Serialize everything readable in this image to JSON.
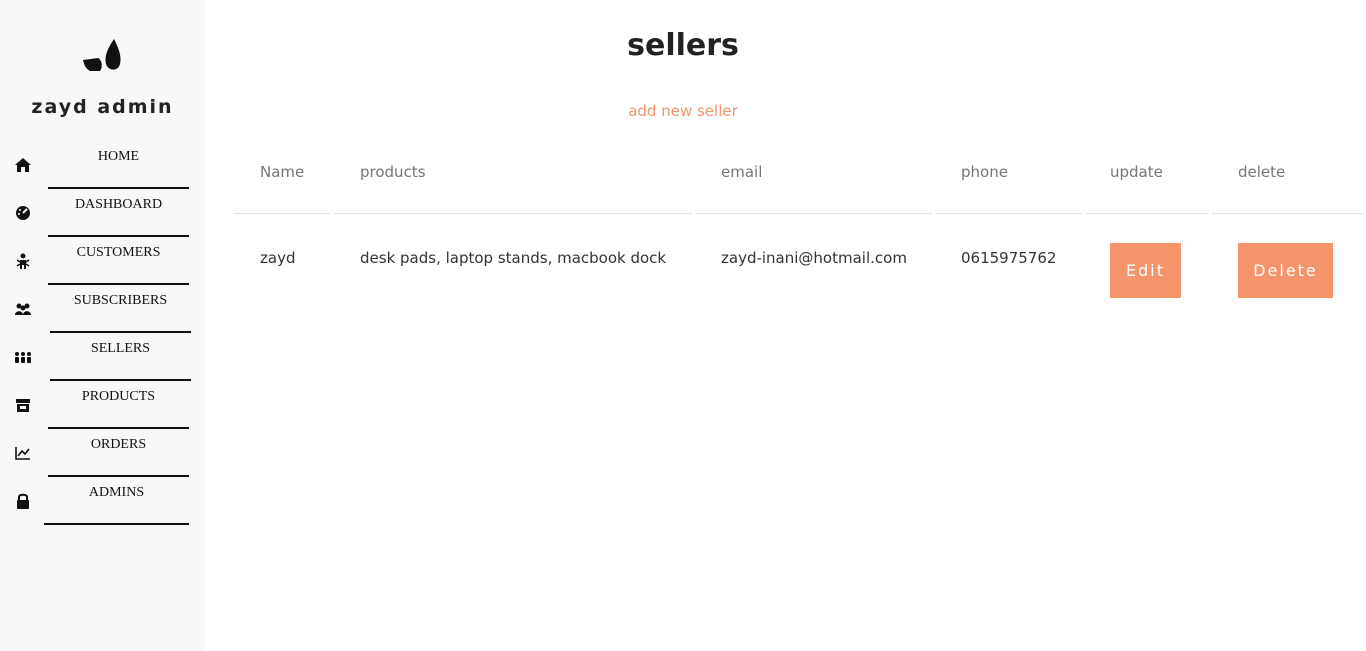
{
  "brand": {
    "name": "zayd admin",
    "logo_icon": "leaf-logo-icon"
  },
  "nav": [
    {
      "label": "HOME",
      "icon": "home-icon"
    },
    {
      "label": "DASHBOARD",
      "icon": "dashboard-icon"
    },
    {
      "label": "CUSTOMERS",
      "icon": "customer-icon"
    },
    {
      "label": "SUBSCRIBERS",
      "icon": "group-icon"
    },
    {
      "label": "SELLERS",
      "icon": "sellers-icon"
    },
    {
      "label": "PRODUCTS",
      "icon": "store-icon"
    },
    {
      "label": "ORDERS",
      "icon": "chart-icon"
    },
    {
      "label": "ADMINS",
      "icon": "lock-icon"
    }
  ],
  "page": {
    "title": "sellers",
    "add_link": "add new seller"
  },
  "table": {
    "headers": [
      "Name",
      "products",
      "email",
      "phone",
      "update",
      "delete"
    ],
    "rows": [
      {
        "name": "zayd",
        "products": "desk pads, laptop stands, macbook dock",
        "email": "zayd-inani@hotmail.com",
        "phone": "0615975762",
        "edit_label": "Edit",
        "delete_label": "Delete"
      }
    ]
  },
  "colors": {
    "accent": "#f5946a",
    "sidebar_bg": "#f8f8f8",
    "text": "#212121"
  }
}
